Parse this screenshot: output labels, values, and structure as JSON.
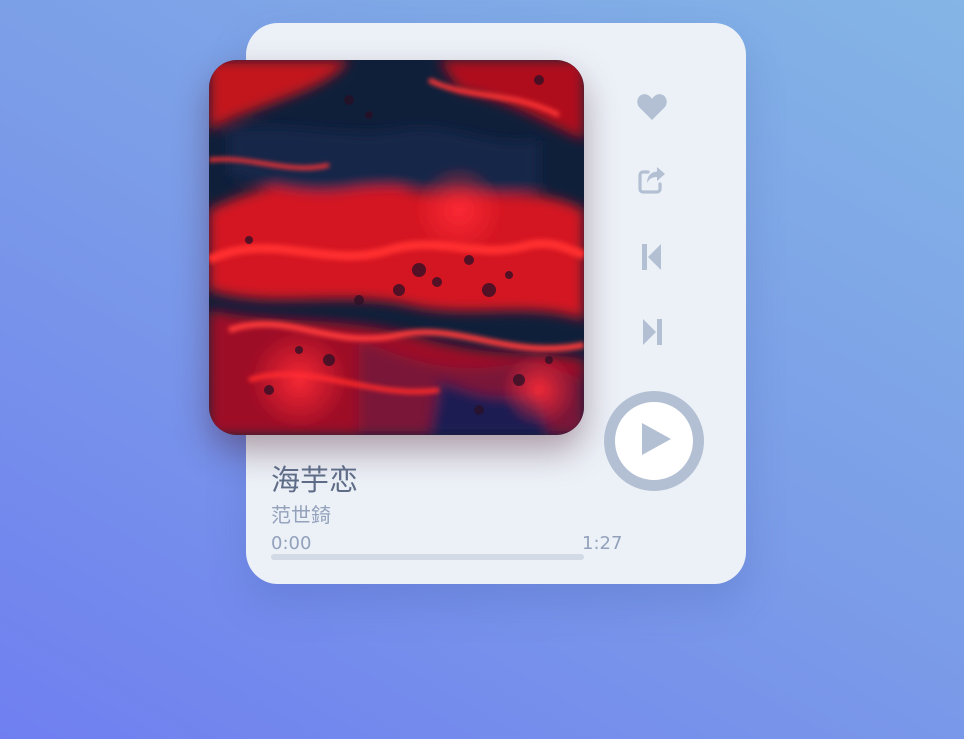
{
  "track": {
    "title": "海芋恋",
    "artist": "范世錡",
    "time_current": "0:00",
    "time_total": "1:27",
    "progress": 0
  },
  "controls": {
    "like_icon": "heart-icon",
    "share_icon": "share-icon",
    "prev_icon": "skip-previous-icon",
    "next_icon": "skip-next-icon",
    "play_icon": "play-icon"
  },
  "colors": {
    "card_background": "#ecf1f8",
    "icon_color": "#b3bfd3",
    "title_color": "#5f6c87",
    "subtext_color": "#93a1bb"
  }
}
